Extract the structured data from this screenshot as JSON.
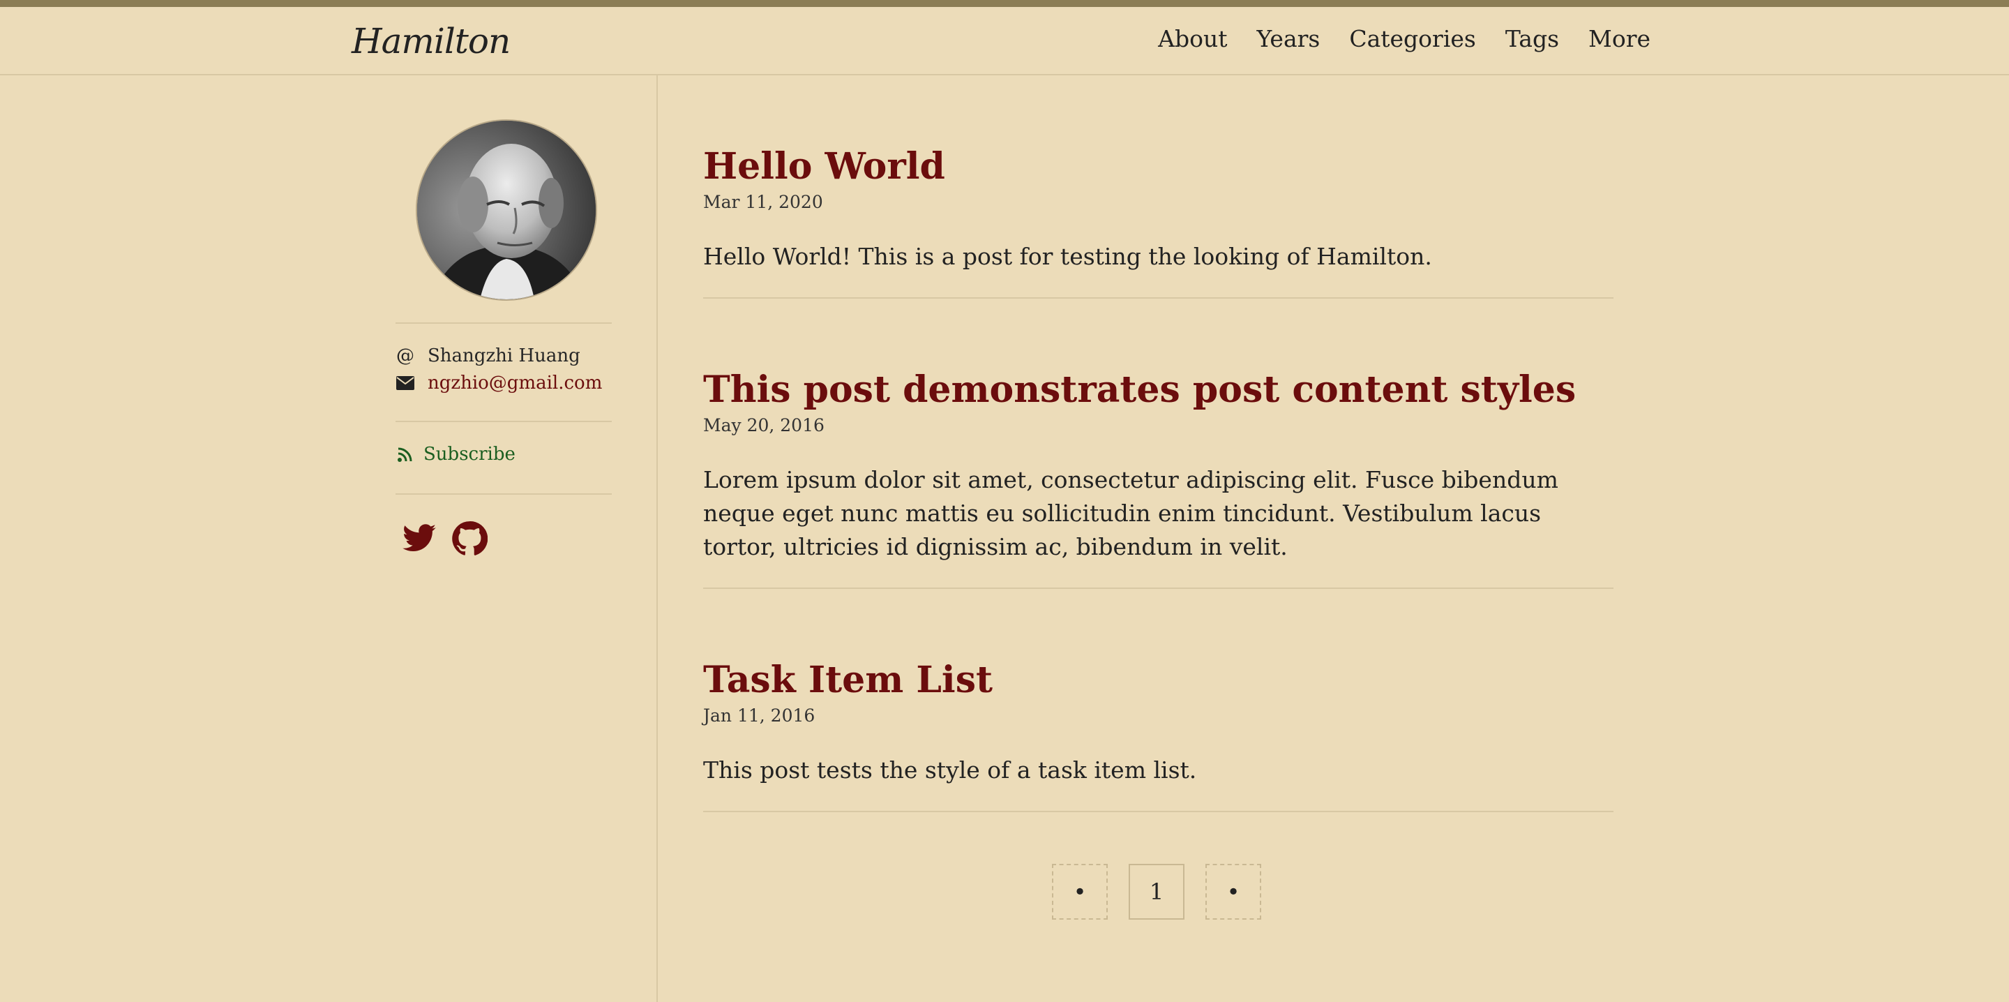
{
  "site": {
    "logo": "Hamilton",
    "nav": [
      "About",
      "Years",
      "Categories",
      "Tags",
      "More"
    ]
  },
  "sidebar": {
    "author_name": "Shangzhi Huang",
    "email": "ngzhio@gmail.com",
    "subscribe_label": "Subscribe",
    "icons": {
      "author": "at-icon",
      "email": "envelope-icon",
      "subscribe": "rss-icon",
      "twitter": "twitter-icon",
      "github": "github-icon"
    }
  },
  "posts": [
    {
      "title": "Hello World",
      "date": "Mar 11, 2020",
      "excerpt": "Hello World! This is a post for testing the looking of Hamilton."
    },
    {
      "title": "This post demonstrates post content styles",
      "date": "May 20, 2016",
      "excerpt": "Lorem ipsum dolor sit amet, consectetur adipiscing elit. Fusce bibendum neque eget nunc mattis eu sollicitudin enim tincidunt. Vestibulum lacus tortor, ultricies id dignissim ac, bibendum in velit."
    },
    {
      "title": "Task Item List",
      "date": "Jan 11, 2016",
      "excerpt": "This post tests the style of a task item list."
    }
  ],
  "pagination": {
    "prev": "•",
    "current": "1",
    "next": "•"
  },
  "colors": {
    "background": "#ecdcb9",
    "accent": "#6b0d0d",
    "subscribe": "#1b5e20",
    "stripe": "#8b7d55"
  }
}
